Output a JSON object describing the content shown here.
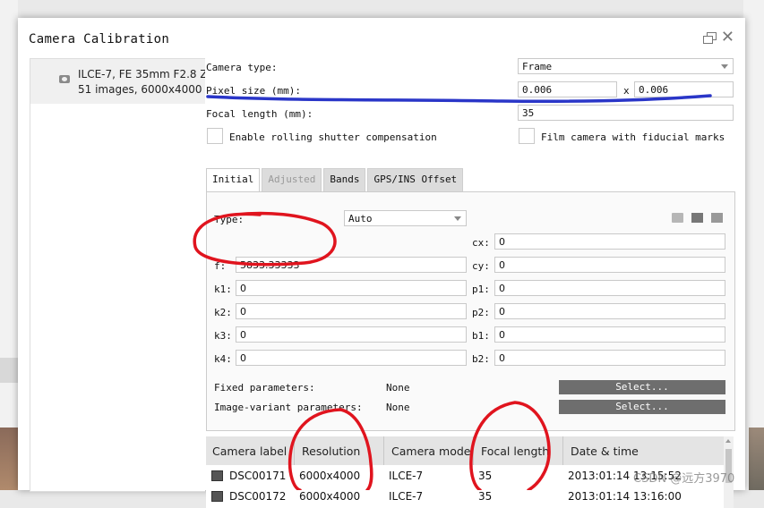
{
  "dialog": {
    "title": "Camera Calibration"
  },
  "camera_list": {
    "entry_line1": "ILCE-7, FE 35mm F2.8 ZA",
    "entry_line2": "51 images, 6000x4000 p"
  },
  "settings": {
    "camera_type_label": "Camera type:",
    "camera_type_value": "Frame",
    "pixel_size_label": "Pixel size (mm):",
    "pixel_size_x": "0.006",
    "pixel_size_sep": "x",
    "pixel_size_y": "0.006",
    "focal_length_label": "Focal length (mm):",
    "focal_length_value": "35",
    "rolling_shutter_label": "Enable rolling shutter compensation",
    "film_camera_label": "Film camera with fiducial marks"
  },
  "tabs": [
    "Initial",
    "Adjusted",
    "Bands",
    "GPS/INS Offset"
  ],
  "initial": {
    "type_label": "Type:",
    "type_value": "Auto",
    "params_left": [
      {
        "label": "f:",
        "value": "5833.33333"
      },
      {
        "label": "k1:",
        "value": "0"
      },
      {
        "label": "k2:",
        "value": "0"
      },
      {
        "label": "k3:",
        "value": "0"
      },
      {
        "label": "k4:",
        "value": "0"
      }
    ],
    "params_right": [
      {
        "label": "cx:",
        "value": "0"
      },
      {
        "label": "cy:",
        "value": "0"
      },
      {
        "label": "p1:",
        "value": "0"
      },
      {
        "label": "p2:",
        "value": "0"
      },
      {
        "label": "b1:",
        "value": "0"
      },
      {
        "label": "b2:",
        "value": "0"
      }
    ],
    "fixed_params_label": "Fixed parameters:",
    "fixed_params_value": "None",
    "variant_params_label": "Image-variant parameters:",
    "variant_params_value": "None",
    "select_label": "Select..."
  },
  "table": {
    "columns": [
      "Camera label",
      "Resolution",
      "Camera model",
      "Focal length",
      "Date & time"
    ],
    "rows": [
      [
        "DSC00171",
        "6000x4000",
        "ILCE-7",
        "35",
        "2013:01:14 13:15:52"
      ],
      [
        "DSC00172",
        "6000x4000",
        "ILCE-7",
        "35",
        "2013:01:14 13:16:00"
      ]
    ]
  },
  "watermark": "CSDN @远方3970",
  "colors": {
    "annotation_red": "#e0141e",
    "annotation_blue": "#2a36c8"
  }
}
